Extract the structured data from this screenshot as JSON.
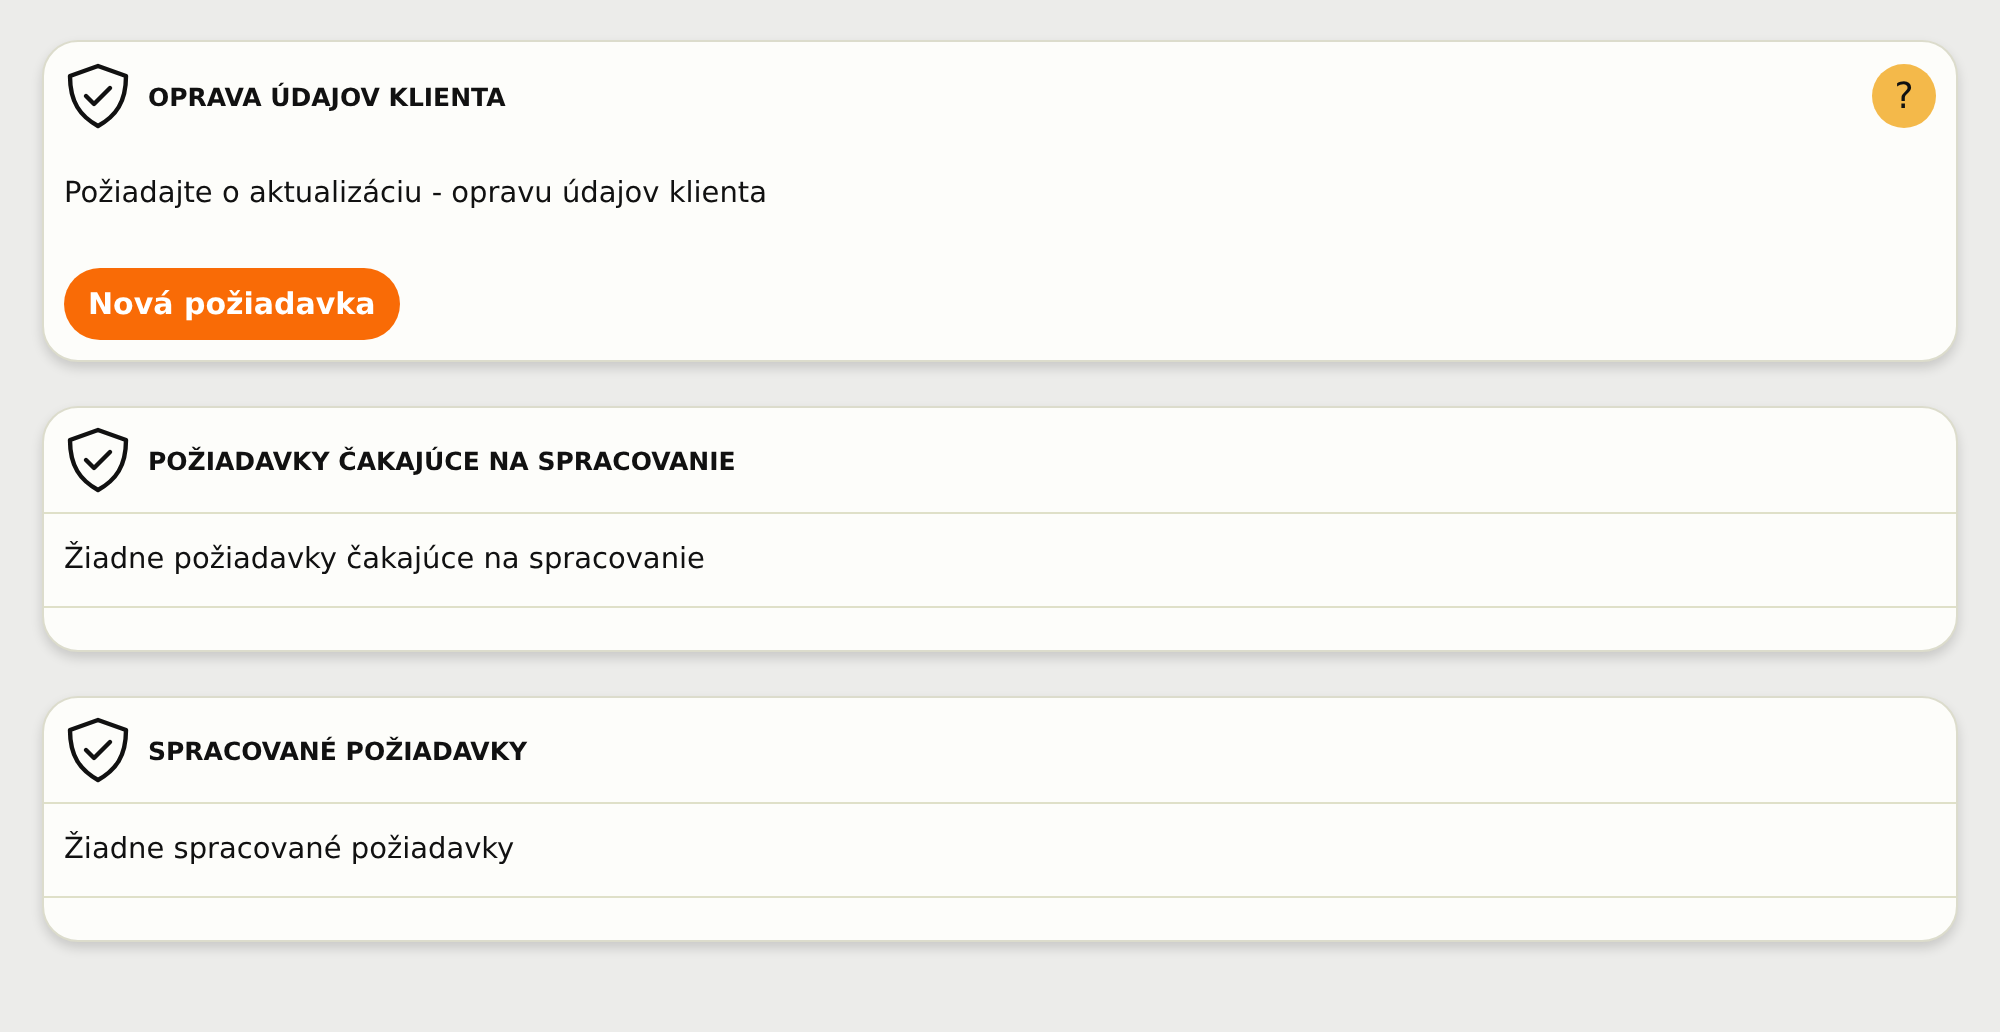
{
  "cards": [
    {
      "kind": "action",
      "title": "OPRAVA ÚDAJOV KLIENTA",
      "help": "?",
      "description": "Požiadajte o aktualizáciu - opravu údajov klienta",
      "button": "Nová požiadavka"
    },
    {
      "kind": "list",
      "title": "POŽIADAVKY ČAKAJÚCE NA SPRACOVANIE",
      "empty_message": "Žiadne požiadavky čakajúce na spracovanie"
    },
    {
      "kind": "list",
      "title": "SPRACOVANÉ POŽIADAVKY",
      "empty_message": "Žiadne spracované požiadavky"
    }
  ]
}
